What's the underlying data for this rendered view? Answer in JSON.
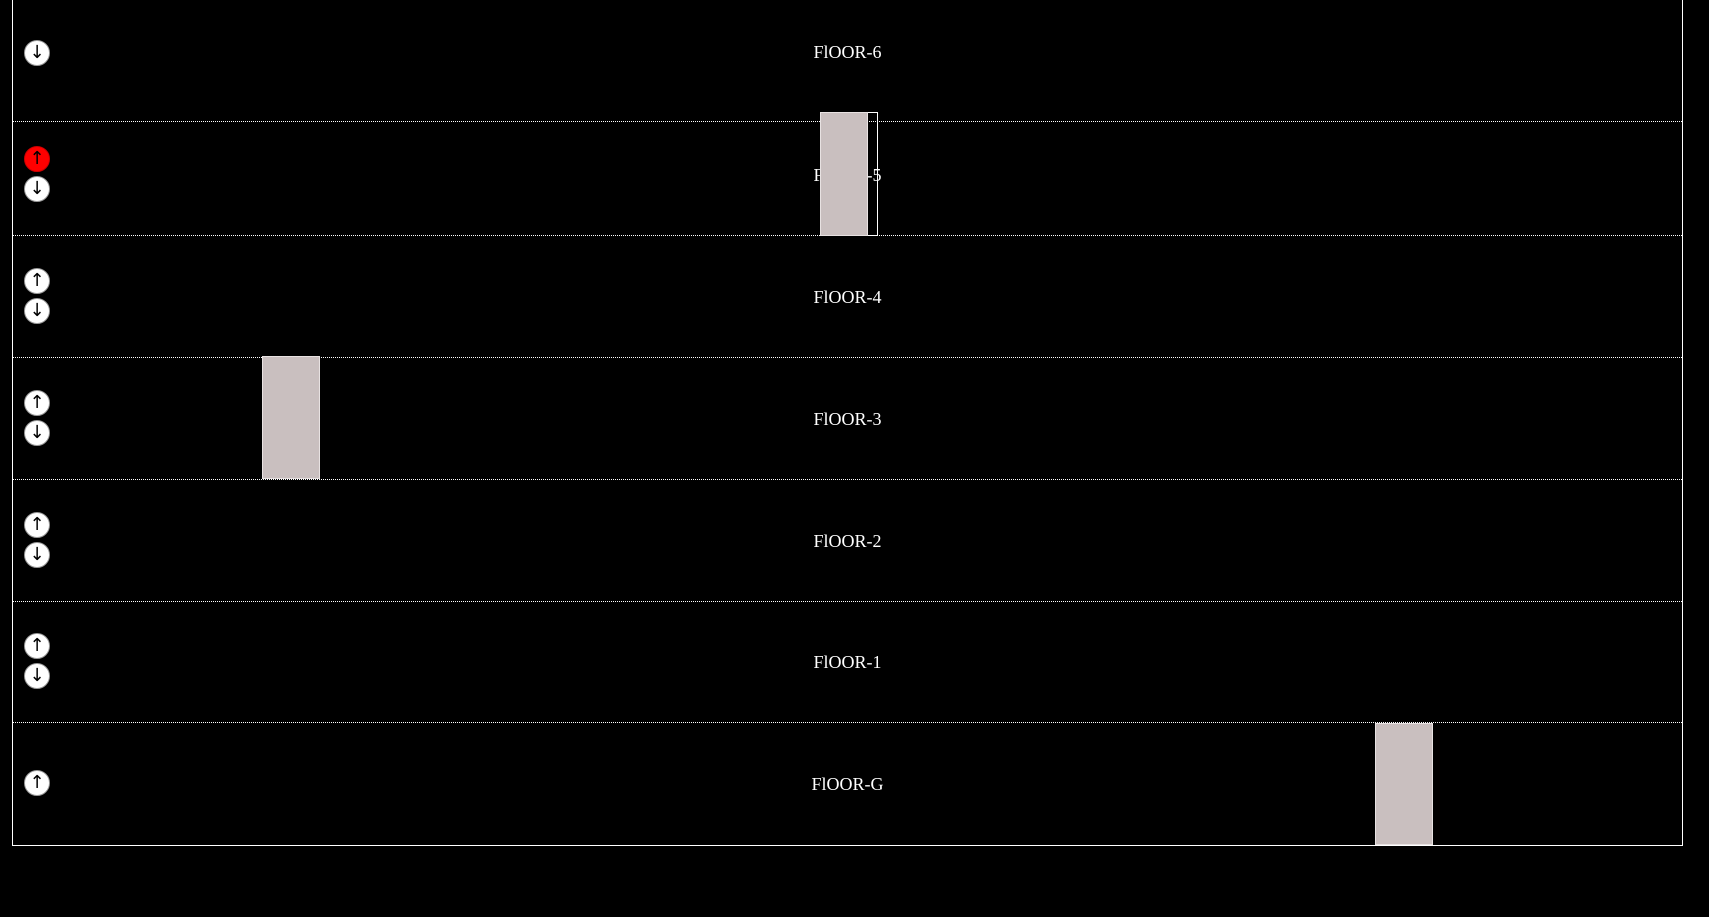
{
  "floors": [
    {
      "label": "FlOOR-6",
      "buttons": [
        {
          "dir": "down",
          "glyph": "↓",
          "active": false
        }
      ]
    },
    {
      "label": "FlOOR-5",
      "buttons": [
        {
          "dir": "up",
          "glyph": "↑",
          "active": true
        },
        {
          "dir": "down",
          "glyph": "↓",
          "active": false
        }
      ]
    },
    {
      "label": "FlOOR-4",
      "buttons": [
        {
          "dir": "up",
          "glyph": "↑",
          "active": false
        },
        {
          "dir": "down",
          "glyph": "↓",
          "active": false
        }
      ]
    },
    {
      "label": "FlOOR-3",
      "buttons": [
        {
          "dir": "up",
          "glyph": "↑",
          "active": false
        },
        {
          "dir": "down",
          "glyph": "↓",
          "active": false
        }
      ]
    },
    {
      "label": "FlOOR-2",
      "buttons": [
        {
          "dir": "up",
          "glyph": "↑",
          "active": false
        },
        {
          "dir": "down",
          "glyph": "↓",
          "active": false
        }
      ]
    },
    {
      "label": "FlOOR-1",
      "buttons": [
        {
          "dir": "up",
          "glyph": "↑",
          "active": false
        },
        {
          "dir": "down",
          "glyph": "↓",
          "active": false
        }
      ]
    },
    {
      "label": "FlOOR-G",
      "buttons": [
        {
          "dir": "up",
          "glyph": "↑",
          "active": false
        }
      ]
    }
  ],
  "lifts": [
    {
      "id": "lift-1",
      "floor": "FlOOR-3"
    },
    {
      "id": "lift-2",
      "floor": "FlOOR-5"
    },
    {
      "id": "lift-3",
      "floor": "FlOOR-G"
    }
  ],
  "colors": {
    "background": "#000000",
    "line": "#ffffff",
    "lift": "#c9bfbf",
    "button": "#ffffff",
    "button_active": "#ff0000"
  }
}
